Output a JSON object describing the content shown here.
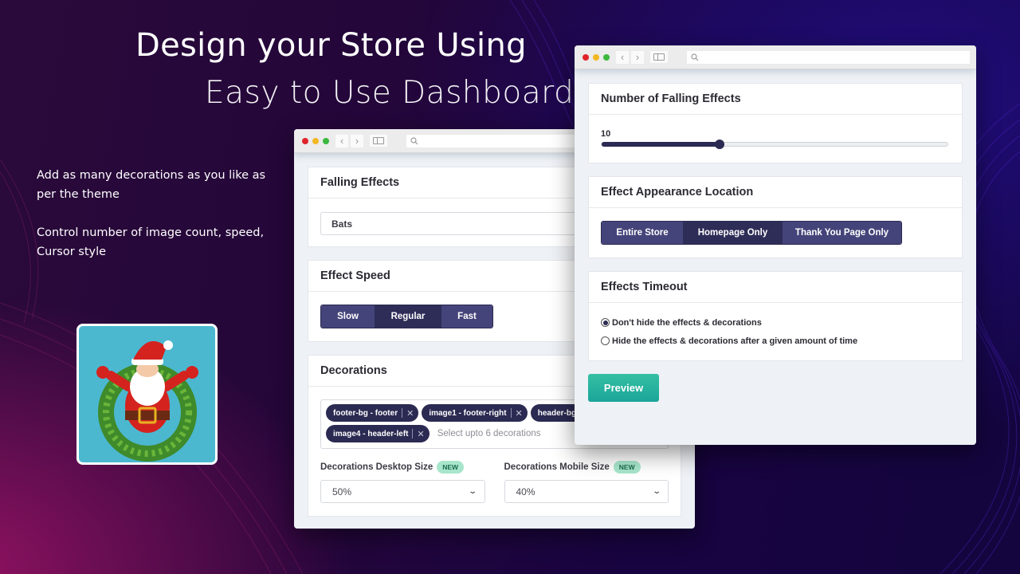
{
  "hero": {
    "headline_line1": "Design your Store Using",
    "headline_line2": "Easy to Use Dashboard",
    "feature1": "Add as many decorations as you like as per the theme",
    "feature2": "Control number of image count, speed, Cursor style",
    "app_icon": "santa-wreath-icon"
  },
  "window1": {
    "falling_effects": {
      "title": "Falling Effects",
      "value": "Bats"
    },
    "effect_speed": {
      "title": "Effect Speed",
      "options": [
        "Slow",
        "Regular",
        "Fast"
      ],
      "selected": "Regular"
    },
    "decorations": {
      "title": "Decorations",
      "tags": [
        "footer-bg - footer",
        "image1 - footer-right",
        "header-bg - header",
        "image4 - header-left"
      ],
      "placeholder": "Select upto 6 decorations",
      "desktop_size_label": "Decorations Desktop Size",
      "desktop_size_badge": "NEW",
      "desktop_size_value": "50%",
      "mobile_size_label": "Decorations Mobile Size",
      "mobile_size_badge": "NEW",
      "mobile_size_value": "40%"
    }
  },
  "window2": {
    "number_of_effects": {
      "title": "Number of Falling Effects",
      "value": "10",
      "fill_fraction": 0.34
    },
    "appearance_location": {
      "title": "Effect Appearance Location",
      "options": [
        "Entire Store",
        "Homepage Only",
        "Thank You Page Only"
      ],
      "selected": "Homepage Only"
    },
    "timeout": {
      "title": "Effects Timeout",
      "options": [
        "Don't hide the effects & decorations",
        "Hide the effects & decorations after a given amount of time"
      ],
      "selected_index": 0
    },
    "preview_label": "Preview"
  },
  "colors": {
    "primary": "#2b2a52",
    "segment": "#45447a",
    "preview": "#1aa59a",
    "badge": "#a8e6cc"
  }
}
